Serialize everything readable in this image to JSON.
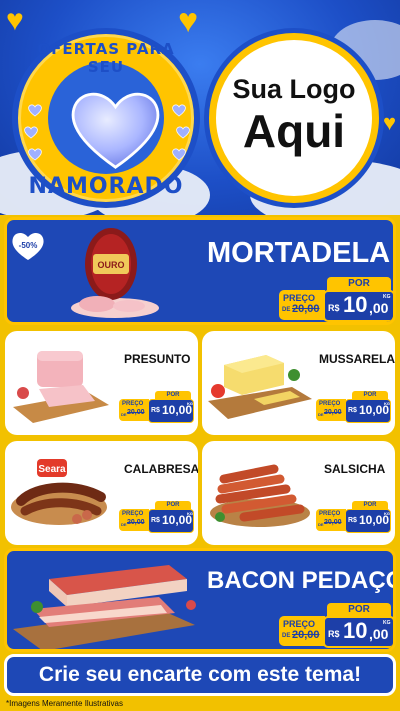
{
  "header": {
    "badge_top": "OFERTAS PARA SEU",
    "badge_bottom": "NAMORADO",
    "logo_line1": "Sua Logo",
    "logo_line2": "Aqui"
  },
  "featured": [
    {
      "name": "MORTADELA",
      "por": "POR",
      "preco": "PREÇO",
      "de": "DE",
      "old_price": "20,00",
      "currency": "R$",
      "price_int": "10",
      "price_dec": ",00",
      "unit": "KG",
      "discount": "-50%",
      "brand": "OURO"
    },
    {
      "name": "BACON PEDAÇO",
      "por": "POR",
      "preco": "PREÇO",
      "de": "DE",
      "old_price": "20,00",
      "currency": "R$",
      "price_int": "10",
      "price_dec": ",00",
      "unit": "KG"
    }
  ],
  "products": [
    {
      "name": "PRESUNTO",
      "por": "POR",
      "preco": "PREÇO",
      "de": "DE",
      "old_price": "20,00",
      "currency": "R$",
      "price": "10,00",
      "unit": "KG"
    },
    {
      "name": "MUSSARELA",
      "por": "POR",
      "preco": "PREÇO",
      "de": "DE",
      "old_price": "20,00",
      "currency": "R$",
      "price": "10,00",
      "unit": "KG"
    },
    {
      "name": "CALABRESA",
      "por": "POR",
      "preco": "PREÇO",
      "de": "DE",
      "old_price": "20,00",
      "currency": "R$",
      "price": "10,00",
      "unit": "KG",
      "brand": "Seara"
    },
    {
      "name": "SALSICHA",
      "por": "POR",
      "preco": "PREÇO",
      "de": "DE",
      "old_price": "20,00",
      "currency": "R$",
      "price": "10,00",
      "unit": "KG"
    }
  ],
  "footer": {
    "cta": "Crie seu encarte com este tema!",
    "disclaimer": "*Imagens Meramente Ilustrativas"
  },
  "colors": {
    "blue": "#1e48b6",
    "yellow": "#ffc400",
    "navy": "#1d3fa8"
  }
}
